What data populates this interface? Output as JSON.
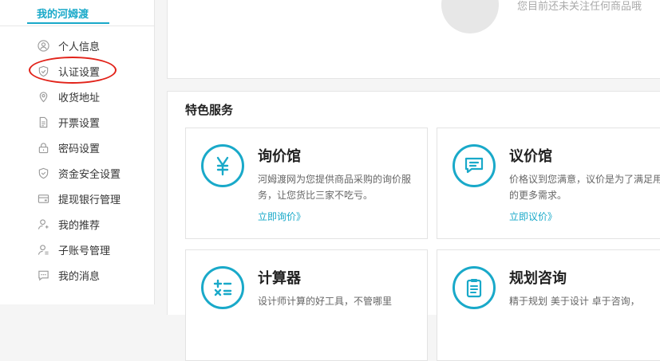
{
  "sidebar": {
    "title": "我的河姆渡",
    "items": [
      {
        "label": "个人信息",
        "icon": "user-circle-icon"
      },
      {
        "label": "认证设置",
        "icon": "shield-check-icon"
      },
      {
        "label": "收货地址",
        "icon": "location-pin-icon"
      },
      {
        "label": "开票设置",
        "icon": "document-icon"
      },
      {
        "label": "密码设置",
        "icon": "lock-icon"
      },
      {
        "label": "资金安全设置",
        "icon": "shield-icon"
      },
      {
        "label": "提现银行管理",
        "icon": "bank-card-icon"
      },
      {
        "label": "我的推荐",
        "icon": "user-add-icon"
      },
      {
        "label": "子账号管理",
        "icon": "sub-account-icon"
      },
      {
        "label": "我的消息",
        "icon": "message-icon"
      }
    ]
  },
  "top_panel": {
    "empty_text": "您目前还未关注任何商品哦"
  },
  "services": {
    "title": "特色服务",
    "cards": [
      {
        "title": "询价馆",
        "desc": "河姆渡网为您提供商品采购的询价服务，让您货比三家不吃亏。",
        "link": "立即询价》",
        "icon": "yen-icon"
      },
      {
        "title": "议价馆",
        "desc": "价格议到您满意，议价是为了满足用户的更多需求。",
        "link": "立即议价》",
        "icon": "chat-icon"
      },
      {
        "title": "计算器",
        "desc": "设计师计算的好工具，不管哪里",
        "link": "",
        "icon": "calculator-icon"
      },
      {
        "title": "规划咨询",
        "desc": "精于规划 美于设计 卓于咨询，",
        "link": "",
        "icon": "clipboard-icon"
      }
    ]
  },
  "colors": {
    "accent": "#19a9c9",
    "annotation": "#e2231a"
  }
}
